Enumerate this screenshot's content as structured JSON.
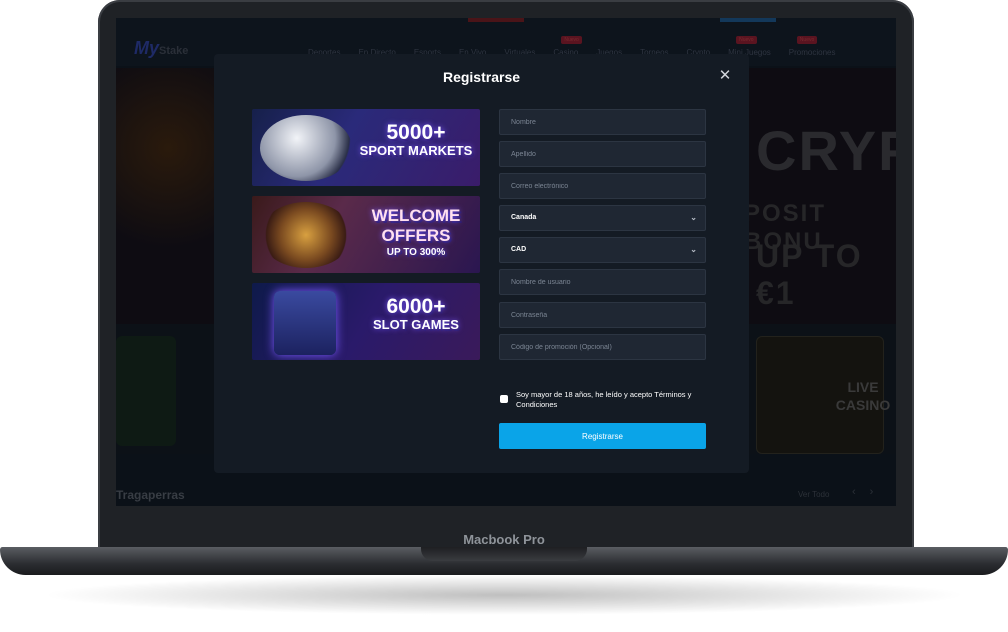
{
  "device": {
    "label": "Macbook Pro"
  },
  "site": {
    "logo": {
      "mark": "My",
      "word": "Stake"
    },
    "nav": [
      {
        "label": "Deportes"
      },
      {
        "label": "En Directo"
      },
      {
        "label": "Esports"
      },
      {
        "label": "En Vivo"
      },
      {
        "label": "Virtuales"
      },
      {
        "label": "Casino",
        "badge": "Nuevo"
      },
      {
        "label": "Juegos"
      },
      {
        "label": "Torneos"
      },
      {
        "label": "Crypto"
      },
      {
        "label": "Mini Juegos",
        "badge": "Nuevo"
      },
      {
        "label": "Promociones",
        "badge": "Nuevo"
      }
    ],
    "hero": {
      "line1": "CRYPT",
      "line2": "POSIT BONU",
      "line3": "UP TO €1"
    },
    "live_card": "LIVE CASINO",
    "section_title": "Tragaperras",
    "see_all": "Ver Todo"
  },
  "modal": {
    "title": "Registrarse",
    "close_icon": "close-icon",
    "promos": [
      {
        "main": "5000+",
        "sub": "SPORT MARKETS"
      },
      {
        "main": "WELCOME",
        "sub": "OFFERS",
        "small": "UP TO 300%"
      },
      {
        "main": "6000+",
        "sub": "SLOT GAMES"
      }
    ],
    "fields": {
      "first_name": {
        "placeholder": "Nombre"
      },
      "last_name": {
        "placeholder": "Apellido"
      },
      "email": {
        "placeholder": "Correo electrónico"
      },
      "country": {
        "value": "Canada"
      },
      "currency": {
        "value": "CAD"
      },
      "username": {
        "placeholder": "Nombre de usuario"
      },
      "password": {
        "placeholder": "Contraseña"
      },
      "promo_code": {
        "placeholder": "Código de promoción (Opcional)"
      }
    },
    "terms": "Soy mayor de 18 años, he leído y acepto Términos y Condiciones",
    "submit_label": "Registrarse"
  },
  "colors": {
    "accent": "#0aa4e8",
    "modal_bg": "#141b24",
    "field_bg": "#1f2733"
  }
}
